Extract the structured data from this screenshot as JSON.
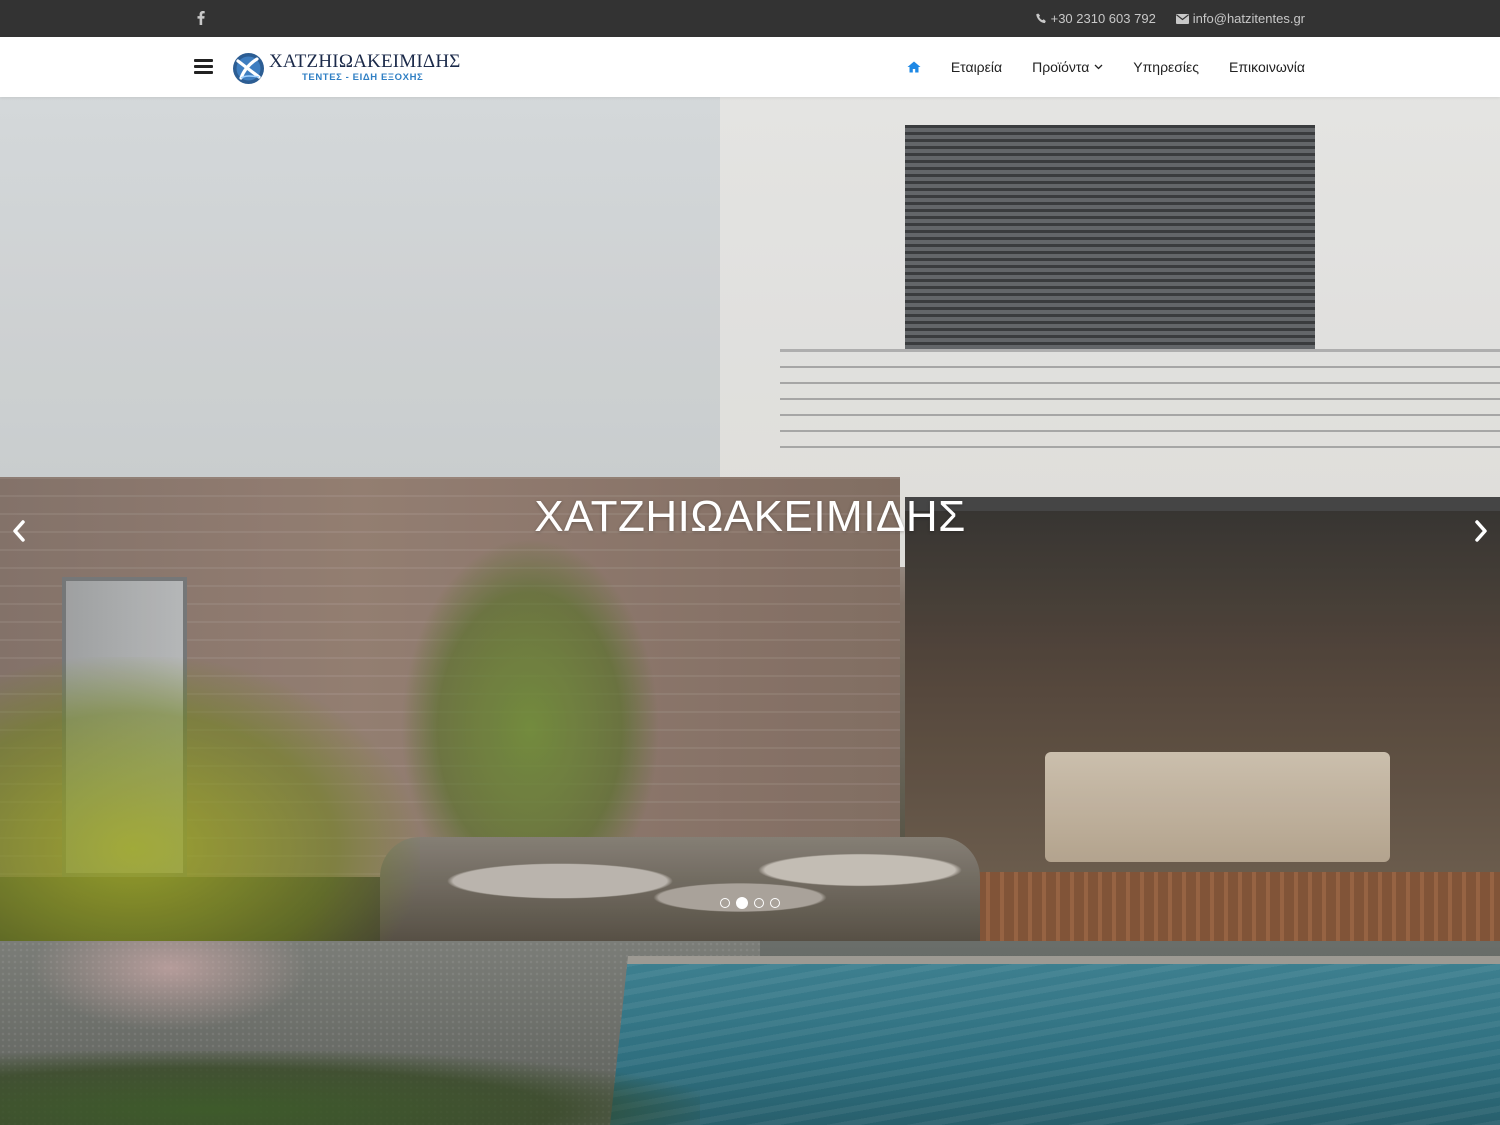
{
  "topbar": {
    "social": [
      {
        "icon": "facebook-icon"
      }
    ],
    "phone": "+30 2310 603 792",
    "email": "info@hatzitentes.gr"
  },
  "header": {
    "logo": {
      "title": "ΧΑΤΖΗΙΩΑΚΕΙΜΙΔΗΣ",
      "subtitle": "ΤΕΝΤΕΣ - ΕΙΔΗ ΕΞΟΧΗΣ"
    },
    "nav": {
      "home_icon": "home-icon",
      "items": [
        "Εταιρεία",
        "Προϊόντα",
        "Υπηρεσίες",
        "Επικοινωνία"
      ]
    }
  },
  "hero": {
    "title": "ΧΑΤΖΗΙΩΑΚΕΙΜΙΔΗΣ",
    "slides_count": 4,
    "active_slide": 2
  },
  "colors": {
    "topbar_bg": "#333333",
    "nav_active": "#1e88e5",
    "logo_blue": "#2f7fc4"
  }
}
